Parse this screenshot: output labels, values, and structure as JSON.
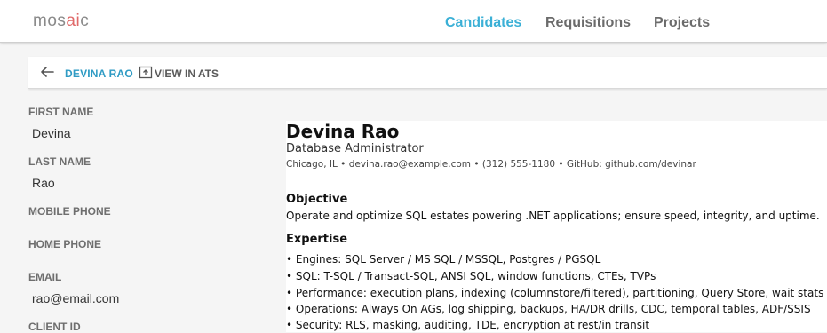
{
  "header": {
    "logo_prefix": "mos",
    "logo_accent": "ai",
    "logo_suffix": "c",
    "nav": [
      {
        "label": "Candidates",
        "active": true
      },
      {
        "label": "Requisitions",
        "active": false
      },
      {
        "label": "Projects",
        "active": false
      }
    ],
    "accent_color": "#3bb0d6"
  },
  "subbar": {
    "candidate_name": "DEVINA RAO",
    "view_in_ats": "VIEW IN ATS"
  },
  "fields": {
    "first_name_label": "FIRST NAME",
    "first_name_value": "Devina",
    "last_name_label": "LAST NAME",
    "last_name_value": "Rao",
    "mobile_phone_label": "MOBILE PHONE",
    "home_phone_label": "HOME PHONE",
    "email_label": "EMAIL",
    "email_value": "rao@email.com",
    "client_id_label": "CLIENT ID"
  },
  "resume": {
    "name": "Devina Rao",
    "title": "Database Administrator",
    "contact": "Chicago, IL • devina.rao@example.com • (312) 555-1180 • GitHub: github.com/devinar",
    "objective_heading": "Objective",
    "objective_text": "Operate and optimize SQL estates powering .NET applications; ensure speed, integrity, and uptime.",
    "expertise_heading": "Expertise",
    "expertise": [
      "• Engines: SQL Server / MS SQL / MSSQL, Postgres / PGSQL",
      "• SQL: T-SQL / Transact-SQL, ANSI SQL, window functions, CTEs, TVPs",
      "• Performance: execution plans, indexing (columnstore/filtered), partitioning, Query Store, wait stats",
      "• Operations: Always On AGs, log shipping, backups, HA/DR drills, CDC, temporal tables, ADF/SSIS",
      "• Security: RLS, masking, auditing, TDE, encryption at rest/in transit"
    ]
  }
}
